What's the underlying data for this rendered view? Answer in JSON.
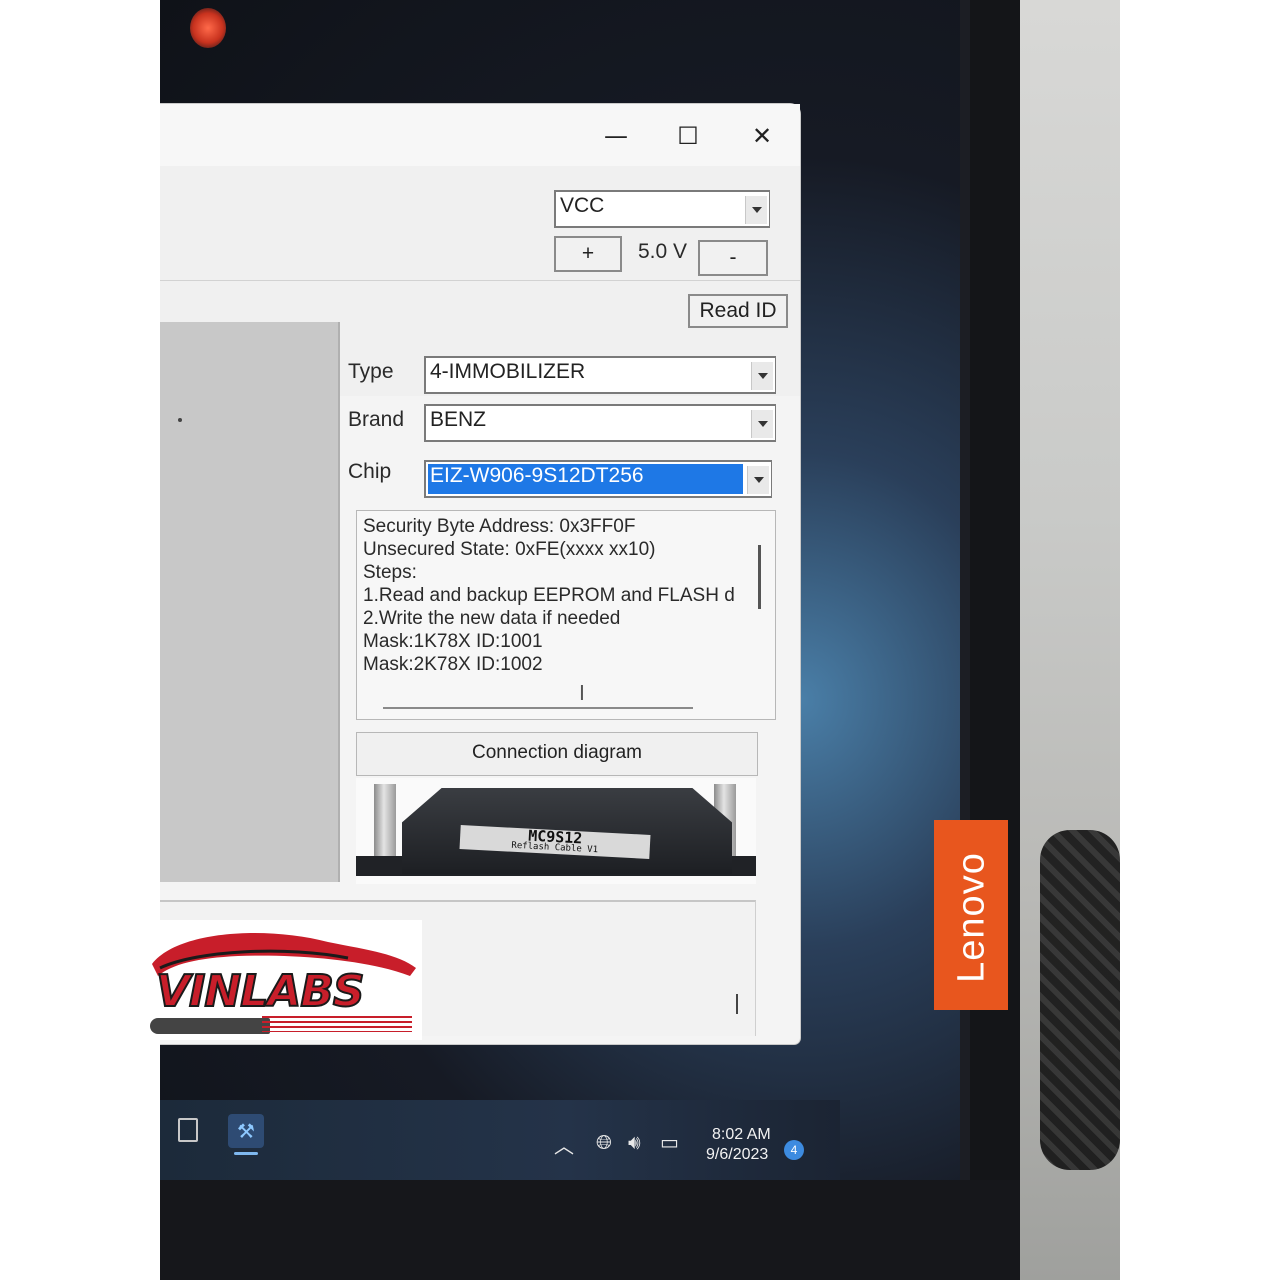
{
  "window": {
    "controls": {
      "minimize": "—",
      "maximize": "☐",
      "close": "✕"
    },
    "power": {
      "supply_select": "VCC",
      "increase_label": "+",
      "voltage_display": "5.0 V",
      "decrease_label": "-"
    },
    "read_id_label": "Read ID",
    "selection": {
      "type_label": "Type",
      "type_value": "4-IMMOBILIZER",
      "brand_label": "Brand",
      "brand_value": "BENZ",
      "chip_label": "Chip",
      "chip_value": "EIZ-W906-9S12DT256"
    },
    "info_lines": [
      "Security Byte Address: 0x3FF0F",
      "Unsecured State: 0xFE(xxxx xx10)",
      "Steps:",
      "1.Read and backup EEPROM and FLASH d",
      "2.Write the new data if needed",
      "Mask:1K78X ID:1001",
      "Mask:2K78X ID:1002"
    ],
    "connection_diagram_label": "Connection diagram",
    "diagram_module_label": "MC9S12",
    "diagram_module_sublabel": "Reflash Cable V1"
  },
  "taskbar": {
    "time": "8:02 AM",
    "date": "9/6/2023",
    "notification_count": "4",
    "tray_icons": [
      "chevron-up-icon",
      "globe-network-icon",
      "volume-icon",
      "battery-icon"
    ]
  },
  "laptop_brand": "Lenovo",
  "watermark_text": "VINLABS",
  "colors": {
    "selection_highlight": "#1e78e6",
    "lenovo_orange": "#e8561e",
    "watermark_red": "#c81e2a"
  }
}
